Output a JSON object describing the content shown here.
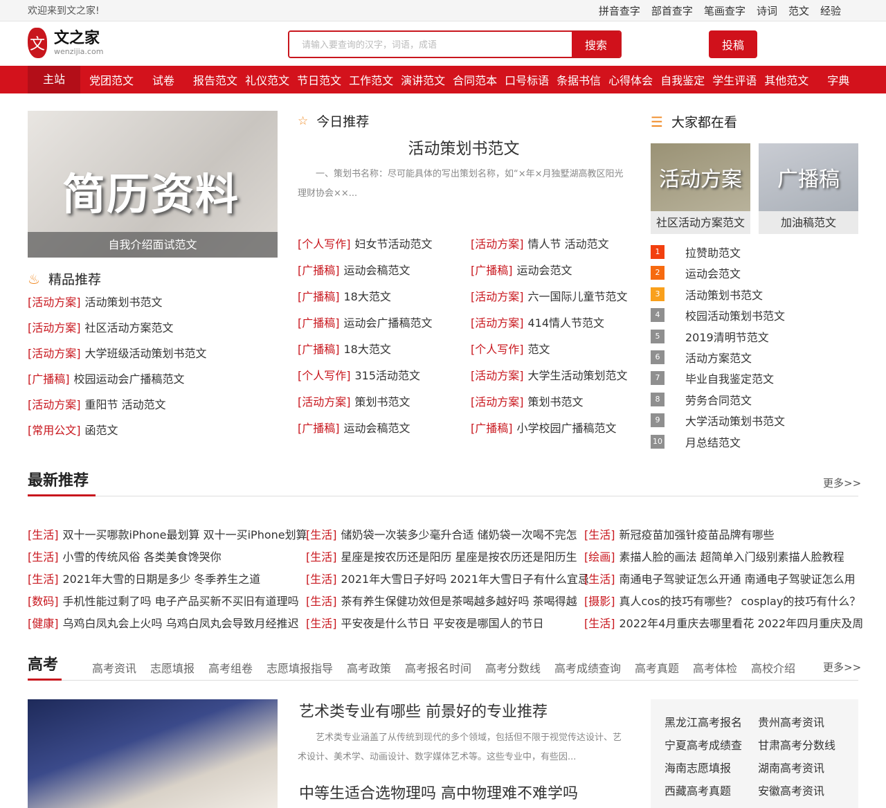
{
  "topbar": {
    "welcome": "欢迎来到文之家!",
    "links": [
      "拼音查字",
      "部首查字",
      "笔画查字",
      "诗词",
      "范文",
      "经验"
    ]
  },
  "header": {
    "logo_char": "文",
    "logo_name": "文之家",
    "logo_domain": "wenzijia.com",
    "search_placeholder": "请输入要查询的汉字，词语，成语",
    "search_button": "搜索",
    "submit_button": "投稿"
  },
  "nav": [
    "主站",
    "党团范文",
    "试卷",
    "报告范文",
    "礼仪范文",
    "节日范文",
    "工作范文",
    "演讲范文",
    "合同范本",
    "口号标语",
    "条据书信",
    "心得体会",
    "自我鉴定",
    "学生评语",
    "其他范文",
    "字典"
  ],
  "feature": {
    "image_text": "简历资料",
    "caption": "自我介绍面试范文"
  },
  "picks": {
    "title": "精品推荐",
    "items": [
      [
        "[活动方案]",
        "活动策划书范文"
      ],
      [
        "[活动方案]",
        "社区活动方案范文"
      ],
      [
        "[活动方案]",
        "大学班级活动策划书范文"
      ],
      [
        "[广播稿]",
        "校园运动会广播稿范文"
      ],
      [
        "[活动方案]",
        "重阳节 活动范文"
      ],
      [
        "[常用公文]",
        "函范文"
      ]
    ]
  },
  "today": {
    "title": "今日推荐",
    "headline": "活动策划书范文",
    "excerpt": "一、策划书名称：尽可能具体的写出策划名称，如“×年×月独墅湖高教区阳光理财协会××...",
    "left": [
      [
        "[个人写作]",
        "妇女节活动范文"
      ],
      [
        "[广播稿]",
        "运动会稿范文"
      ],
      [
        "[广播稿]",
        "18大范文"
      ],
      [
        "[广播稿]",
        "运动会广播稿范文"
      ],
      [
        "[广播稿]",
        "18大范文"
      ],
      [
        "[个人写作]",
        "315活动范文"
      ],
      [
        "[活动方案]",
        "策划书范文"
      ],
      [
        "[广播稿]",
        "运动会稿范文"
      ]
    ],
    "right": [
      [
        "[活动方案]",
        "情人节 活动范文"
      ],
      [
        "[广播稿]",
        "运动会范文"
      ],
      [
        "[活动方案]",
        "六一国际儿童节范文"
      ],
      [
        "[活动方案]",
        "414情人节范文"
      ],
      [
        "[个人写作]",
        "范文"
      ],
      [
        "[活动方案]",
        "大学生活动策划范文"
      ],
      [
        "[活动方案]",
        "策划书范文"
      ],
      [
        "[广播稿]",
        "小学校园广播稿范文"
      ]
    ]
  },
  "popular": {
    "title": "大家都在看",
    "thumbs": [
      {
        "image_text": "活动方案",
        "caption": "社区活动方案范文"
      },
      {
        "image_text": "广播稿",
        "caption": "加油稿范文"
      }
    ],
    "ranks": [
      {
        "n": "1",
        "t": "拉赞助范文"
      },
      {
        "n": "2",
        "t": "运动会范文"
      },
      {
        "n": "3",
        "t": "活动策划书范文"
      },
      {
        "n": "4",
        "t": "校园活动策划书范文"
      },
      {
        "n": "5",
        "t": "2019清明节范文"
      },
      {
        "n": "6",
        "t": "活动方案范文"
      },
      {
        "n": "7",
        "t": "毕业自我鉴定范文"
      },
      {
        "n": "8",
        "t": "劳务合同范文"
      },
      {
        "n": "9",
        "t": "大学活动策划书范文"
      },
      {
        "n": "10",
        "t": "月总结范文"
      }
    ],
    "rank_colors": [
      "#f2400f",
      "#f66a10",
      "#f9a01c"
    ]
  },
  "latest": {
    "title": "最新推荐",
    "more": "更多>>",
    "columns": [
      [
        [
          "[生活]",
          "双十一买哪款iPhone最划算 双十一买iPhone划算"
        ],
        [
          "[生活]",
          "小雪的传统风俗 各类美食馋哭你"
        ],
        [
          "[生活]",
          "2021年大雪的日期是多少 冬季养生之道"
        ],
        [
          "[数码]",
          "手机性能过剩了吗 电子产品买新不买旧有道理吗"
        ],
        [
          "[健康]",
          "乌鸡白凤丸会上火吗 乌鸡白凤丸会导致月经推迟"
        ]
      ],
      [
        [
          "[生活]",
          "储奶袋一次装多少毫升合适 储奶袋一次喝不完怎"
        ],
        [
          "[生活]",
          "星座是按农历还是阳历 星座是按农历还是阳历生"
        ],
        [
          "[生活]",
          "2021年大雪日子好吗 2021年大雪日子有什么宜忌"
        ],
        [
          "[生活]",
          "茶有养生保健功效但是茶喝越多越好吗 茶喝得越"
        ],
        [
          "[生活]",
          "平安夜是什么节日 平安夜是哪国人的节日"
        ]
      ],
      [
        [
          "[生活]",
          "新冠疫苗加强针疫苗品牌有哪些"
        ],
        [
          "[绘画]",
          "素描人脸的画法 超简单入门级别素描人脸教程"
        ],
        [
          "[生活]",
          "南通电子驾驶证怎么开通 南通电子驾驶证怎么用"
        ],
        [
          "[摄影]",
          "真人cos的技巧有哪些？ cosplay的技巧有什么？"
        ],
        [
          "[生活]",
          "2022年4月重庆去哪里看花 2022年四月重庆及周"
        ]
      ]
    ]
  },
  "gaokao": {
    "title": "高考",
    "more": "更多>>",
    "tabs": [
      "高考资讯",
      "志愿填报",
      "高考组卷",
      "志愿填报指导",
      "高考政策",
      "高考报名时间",
      "高考分数线",
      "高考成绩查询",
      "高考真题",
      "高考体检",
      "高校介绍"
    ],
    "article1_title": "艺术类专业有哪些 前景好的专业推荐",
    "article1_excerpt": "艺术类专业涵盖了从传统到现代的多个领域，包括但不限于视觉传达设计、艺术设计、美术学、动画设计、数字媒体艺术等。这些专业中，有些因...",
    "article2_title": "中等生适合选物理吗 高中物理难不难学吗",
    "side_links": [
      "黑龙江高考报名",
      "贵州高考资讯",
      "宁夏高考成绩查",
      "甘肃高考分数线",
      "海南志愿填报",
      "湖南高考资讯",
      "西藏高考真题",
      "安徽高考资讯"
    ]
  }
}
